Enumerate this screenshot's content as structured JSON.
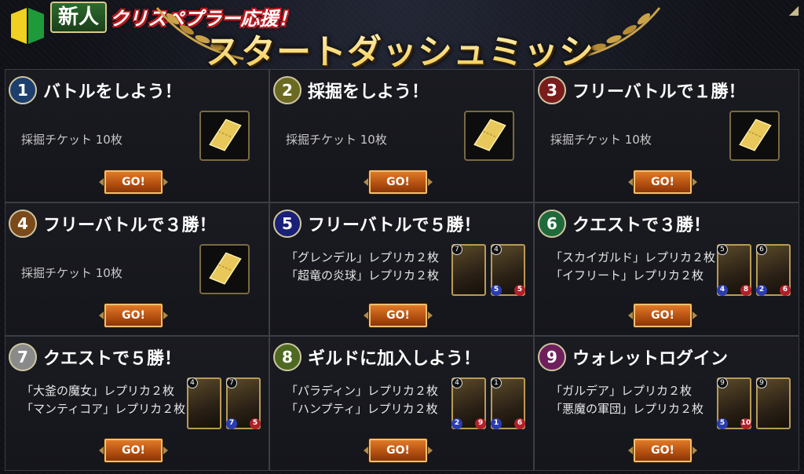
{
  "header": {
    "badge": "新人",
    "subtitle": "クリスペプラー応援！",
    "title": "スタートダッシュミッション"
  },
  "colors": {
    "title_gold": "#f2c43a",
    "go_orange": "#c45a14",
    "ticket_gold": "#e8c85a"
  },
  "missions": [
    {
      "num": "1",
      "color": "#1d3f6e",
      "title": "バトルをしよう！",
      "reward_type": "ticket",
      "reward": "採掘チケット 10枚",
      "button": "GO!"
    },
    {
      "num": "2",
      "color": "#6b6a22",
      "title": "採掘をしよう！",
      "reward_type": "ticket",
      "reward": "採掘チケット 10枚",
      "button": "GO!"
    },
    {
      "num": "3",
      "color": "#7a1c1c",
      "title": "フリーバトルで１勝！",
      "reward_type": "ticket",
      "reward": "採掘チケット 10枚",
      "button": "GO!"
    },
    {
      "num": "4",
      "color": "#7a4a1a",
      "title": "フリーバトルで３勝！",
      "reward_type": "ticket",
      "reward": "採掘チケット 10枚",
      "button": "GO!"
    },
    {
      "num": "5",
      "color": "#1a1f78",
      "title": "フリーバトルで５勝！",
      "reward_type": "cards",
      "rewards": [
        "「グレンデル」レプリカ２枚",
        "「超竜の炎球」レプリカ２枚"
      ],
      "cards": [
        {
          "cost": "7",
          "atk": "",
          "def": ""
        },
        {
          "cost": "4",
          "atk": "5",
          "def": "5"
        }
      ],
      "button": "GO!"
    },
    {
      "num": "6",
      "color": "#1f6a3a",
      "title": "クエストで３勝！",
      "reward_type": "cards",
      "rewards": [
        "「スカイガルド」レプリカ２枚",
        "「イフリート」レプリカ２枚"
      ],
      "cards": [
        {
          "cost": "5",
          "atk": "4",
          "def": "8"
        },
        {
          "cost": "6",
          "atk": "2",
          "def": "6"
        }
      ],
      "button": "GO!"
    },
    {
      "num": "7",
      "color": "#8a8a8a",
      "title": "クエストで５勝！",
      "reward_type": "cards",
      "rewards": [
        "「大釜の魔女」レプリカ２枚",
        "「マンティコア」レプリカ２枚"
      ],
      "cards": [
        {
          "cost": "4",
          "atk": "",
          "def": ""
        },
        {
          "cost": "7",
          "atk": "7",
          "def": "5"
        }
      ],
      "button": "GO!"
    },
    {
      "num": "8",
      "color": "#4e6a22",
      "title": "ギルドに加入しよう！",
      "reward_type": "cards",
      "rewards": [
        "「パラディン」レプリカ２枚",
        "「ハンプティ」レプリカ２枚"
      ],
      "cards": [
        {
          "cost": "4",
          "atk": "2",
          "def": "9"
        },
        {
          "cost": "1",
          "atk": "1",
          "def": "6"
        }
      ],
      "button": "GO!"
    },
    {
      "num": "9",
      "color": "#6e1f5e",
      "title": "ウォレットログイン",
      "reward_type": "cards",
      "rewards": [
        "「ガルデア」レプリカ２枚",
        "「悪魔の軍団」レプリカ２枚"
      ],
      "cards": [
        {
          "cost": "9",
          "atk": "5",
          "def": "10"
        },
        {
          "cost": "9",
          "atk": "",
          "def": ""
        }
      ],
      "button": "GO!"
    }
  ]
}
